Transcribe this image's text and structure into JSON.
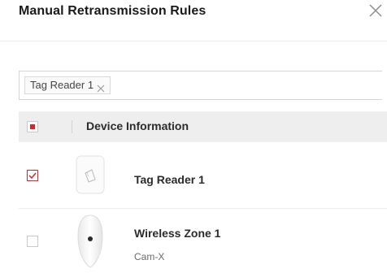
{
  "dialog": {
    "title": "Manual Retransmission Rules",
    "close_icon": "close-icon"
  },
  "filter": {
    "tags": [
      {
        "label": "Tag Reader 1",
        "remove_icon": "close-icon"
      }
    ]
  },
  "table": {
    "header": {
      "select_all_state": "partial",
      "column_label": "Device Information"
    },
    "rows": [
      {
        "checked": true,
        "name": "Tag Reader 1",
        "subtitle": "",
        "icon": "tag-reader-icon"
      },
      {
        "checked": false,
        "name": "Wireless Zone 1",
        "subtitle": "Cam-X",
        "icon": "pir-camera-icon"
      }
    ]
  },
  "colors": {
    "accent": "#e0222a",
    "header_bg": "#eeeeee",
    "border": "#d6d6d6"
  }
}
